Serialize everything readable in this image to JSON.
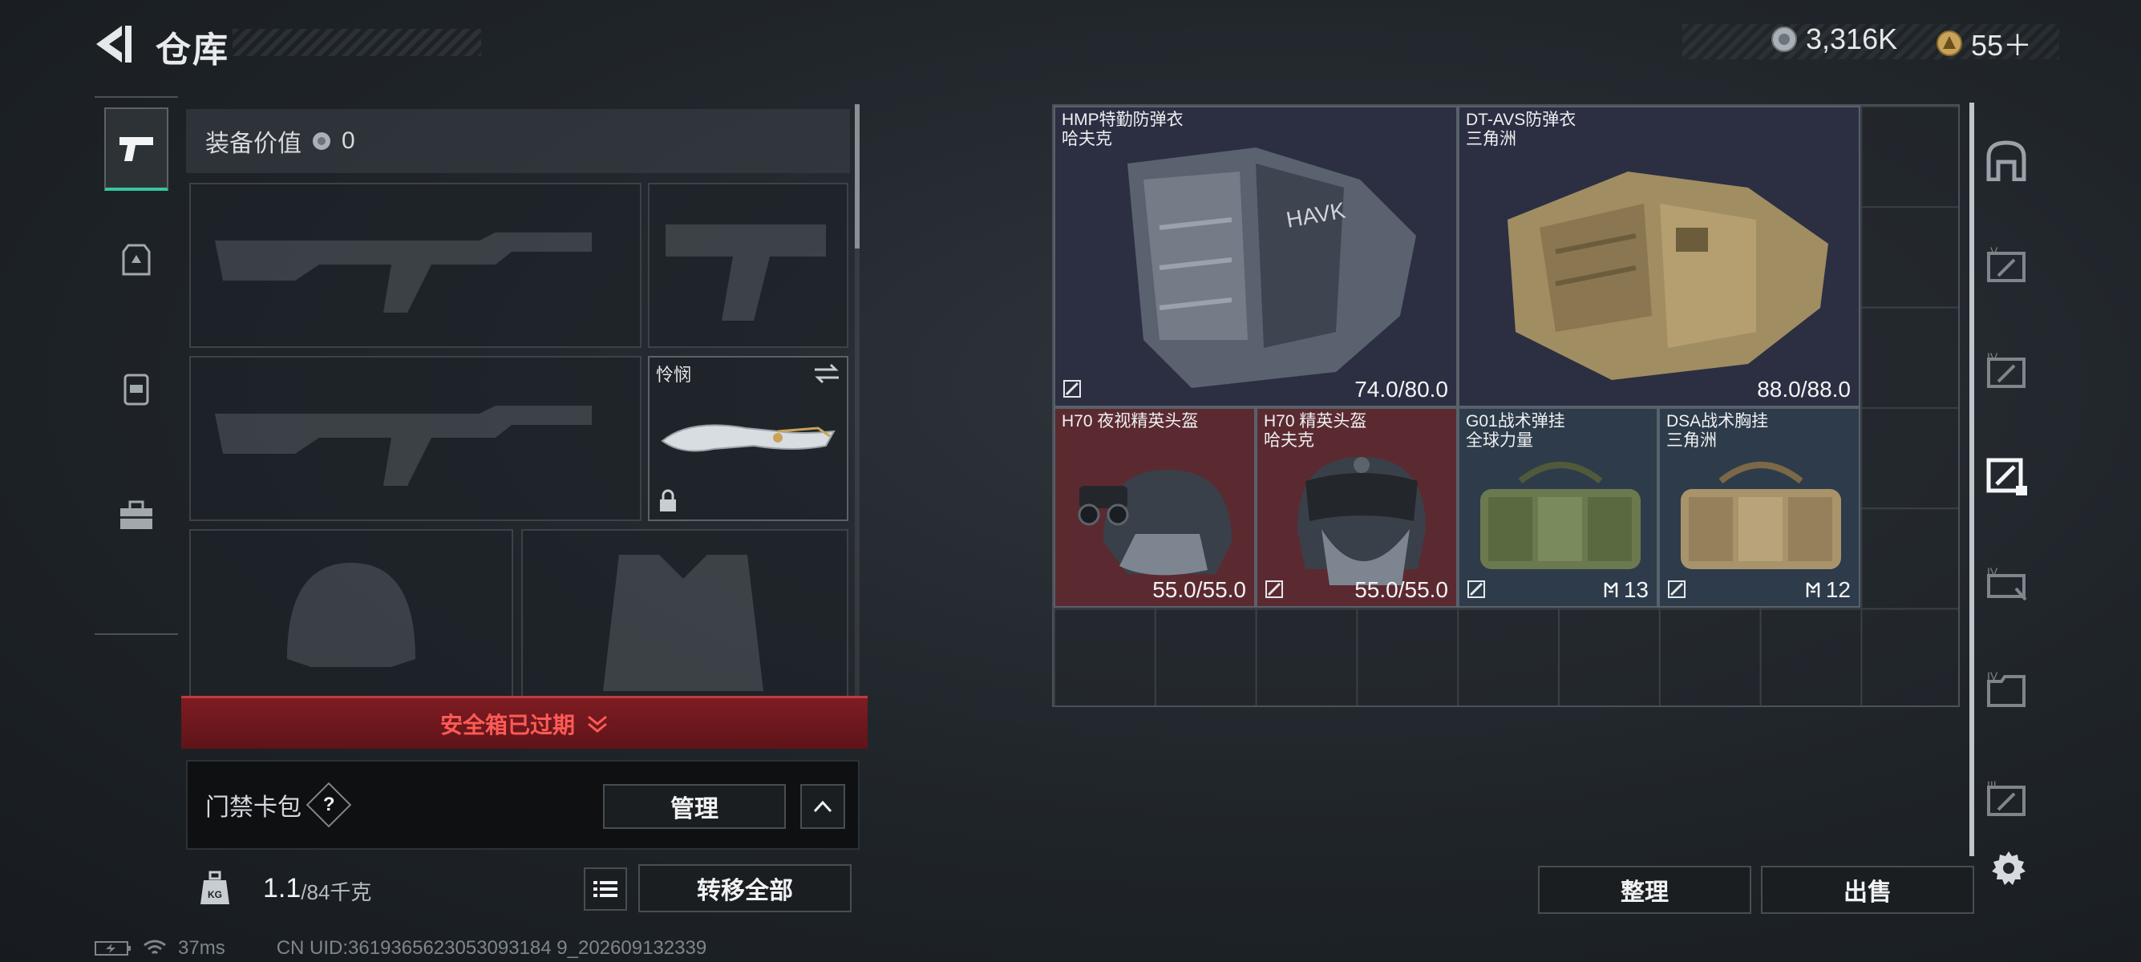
{
  "header": {
    "title": "仓库",
    "currency_silver": "3,316K",
    "currency_gold": "55＋"
  },
  "left_panel": {
    "equip_value_label": "装备价值",
    "equip_value": "0",
    "melee_slot_name": "怜悯",
    "expired_notice": "安全箱已过期",
    "keycard_label": "门禁卡包",
    "keycard_help": "?",
    "manage_label": "管理",
    "weight_value": "1.1",
    "weight_capacity": "/84千克",
    "transfer_all_label": "转移全部"
  },
  "warehouse": {
    "items": [
      {
        "name": "HMP特勤防弹衣",
        "brand": "哈夫克",
        "value": "74.0/80.0",
        "bg": "#2c2f42"
      },
      {
        "name": "DT-AVS防弹衣",
        "brand": "三角洲",
        "value": "88.0/88.0",
        "bg": "#2c2f42"
      },
      {
        "name": "H70 夜视精英头盔",
        "brand": "",
        "value": "55.0/55.0",
        "bg": "#5b2a30"
      },
      {
        "name": "H70 精英头盔",
        "brand": "哈夫克",
        "value": "55.0/55.0",
        "bg": "#5b2a30"
      },
      {
        "name": "G01战术弹挂",
        "brand": "全球力量",
        "value": "13",
        "bg": "#2e3b4a"
      },
      {
        "name": "DSA战术胸挂",
        "brand": "三角洲",
        "value": "12",
        "bg": "#2e3b4a"
      }
    ],
    "tidy_label": "整理",
    "sell_label": "出售"
  },
  "status": {
    "ping": "37ms",
    "uid": "CN UID:3619365623053093184 9_202609132339"
  },
  "colors": {
    "accent_green": "#33c6a0",
    "expired_red": "#ff5a55",
    "red_tile": "#5b2a30",
    "blue_tile": "#2e3b4a",
    "purple_tile": "#2c2f42"
  }
}
